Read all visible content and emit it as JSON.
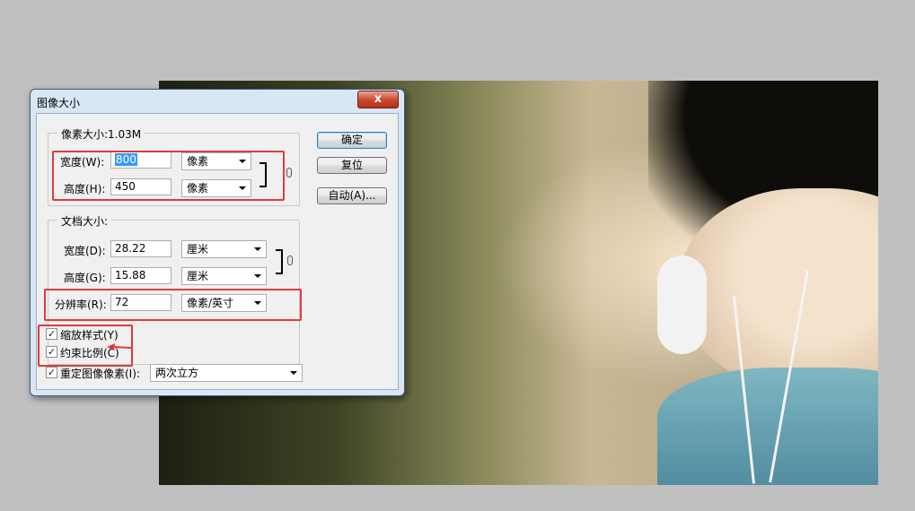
{
  "dialog": {
    "title": "图像大小",
    "close_label": "x",
    "buttons": {
      "ok": "确定",
      "reset": "复位",
      "auto": "自动(A)..."
    },
    "pixel_dimensions": {
      "legend": "像素大小:1.03M",
      "width_label": "宽度(W):",
      "width_value": "800",
      "width_unit": "像素",
      "height_label": "高度(H):",
      "height_value": "450",
      "height_unit": "像素"
    },
    "document_size": {
      "legend": "文档大小:",
      "width_label": "宽度(D):",
      "width_value": "28.22",
      "width_unit": "厘米",
      "height_label": "高度(G):",
      "height_value": "15.88",
      "height_unit": "厘米",
      "resolution_label": "分辨率(R):",
      "resolution_value": "72",
      "resolution_unit": "像素/英寸"
    },
    "options": {
      "scale_styles_label": "缩放样式(Y)",
      "scale_styles_checked": true,
      "constrain_label": "约束比例(C)",
      "constrain_checked": true,
      "resample_label": "重定图像像素(I):",
      "resample_checked": true,
      "resample_method": "两次立方"
    }
  },
  "check_glyph": "✓",
  "colors": {
    "highlight_box": "#e23a3a",
    "selection": "#3399ff",
    "title_bar": "#d9e6f4"
  }
}
